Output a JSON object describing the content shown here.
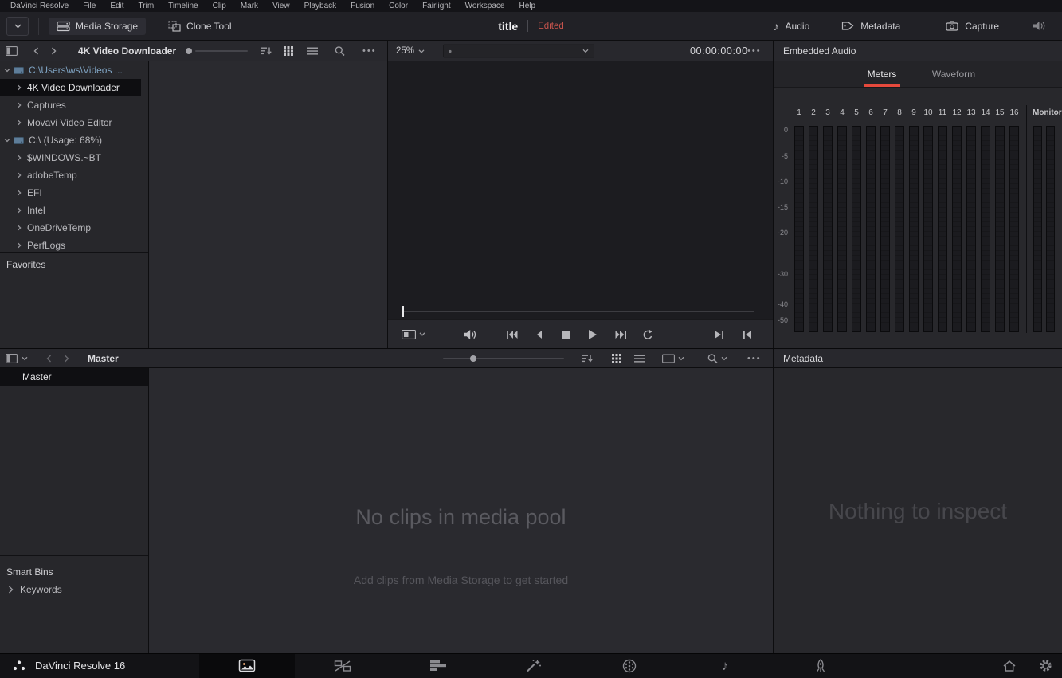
{
  "menubar": {
    "items": [
      "DaVinci Resolve",
      "File",
      "Edit",
      "Trim",
      "Timeline",
      "Clip",
      "Mark",
      "View",
      "Playback",
      "Fusion",
      "Color",
      "Fairlight",
      "Workspace",
      "Help"
    ]
  },
  "toolbar": {
    "media_storage_label": "Media Storage",
    "clone_tool_label": "Clone Tool",
    "project_title": "title",
    "project_status": "Edited",
    "audio_label": "Audio",
    "metadata_label": "Metadata",
    "capture_label": "Capture"
  },
  "storage_header": {
    "breadcrumb": "4K Video Downloader"
  },
  "viewer": {
    "zoom_value": "25%",
    "timecode": "00:00:00:00"
  },
  "storage_tree": {
    "items": [
      {
        "label": "C:\\Users\\ws\\Videos ...",
        "kind": "disk",
        "expanded": true,
        "accent": true
      },
      {
        "label": "4K Video Downloader",
        "kind": "folder",
        "selected": true
      },
      {
        "label": "Captures",
        "kind": "folder"
      },
      {
        "label": "Movavi Video Editor",
        "kind": "folder"
      },
      {
        "label": "C:\\ (Usage: 68%)",
        "kind": "disk",
        "expanded": true
      },
      {
        "label": "$WINDOWS.~BT",
        "kind": "folder"
      },
      {
        "label": "adobeTemp",
        "kind": "folder"
      },
      {
        "label": "EFI",
        "kind": "folder"
      },
      {
        "label": "Intel",
        "kind": "folder"
      },
      {
        "label": "OneDriveTemp",
        "kind": "folder"
      },
      {
        "label": "PerfLogs",
        "kind": "folder"
      }
    ],
    "favorites_label": "Favorites"
  },
  "audio_panel": {
    "title": "Embedded Audio",
    "tabs": [
      {
        "label": "Meters",
        "active": true
      },
      {
        "label": "Waveform",
        "active": false
      }
    ],
    "channels": [
      "1",
      "2",
      "3",
      "4",
      "5",
      "6",
      "7",
      "8",
      "9",
      "10",
      "11",
      "12",
      "13",
      "14",
      "15",
      "16"
    ],
    "monitor_label": "Monitor",
    "db_labels": [
      "0",
      "-5",
      "-10",
      "-15",
      "-20",
      "-30",
      "-40",
      "-50"
    ]
  },
  "media_pool": {
    "header_label": "Master",
    "bins": [
      {
        "label": "Master",
        "selected": true
      }
    ],
    "smart_bins_label": "Smart Bins",
    "keywords_label": "Keywords",
    "empty_title": "No clips in media pool",
    "empty_subtitle": "Add clips from Media Storage to get started"
  },
  "metadata_panel": {
    "title": "Metadata",
    "empty_text": "Nothing to inspect"
  },
  "statusbar": {
    "app_label": "DaVinci Resolve 16",
    "pages": [
      {
        "name": "media",
        "active": true
      },
      {
        "name": "cut",
        "active": false
      },
      {
        "name": "edit",
        "active": false
      },
      {
        "name": "fusion",
        "active": false
      },
      {
        "name": "color",
        "active": false
      },
      {
        "name": "fairlight",
        "active": false
      },
      {
        "name": "deliver",
        "active": false
      }
    ]
  },
  "colors": {
    "accent_red": "#e5493c",
    "status_red": "#c4534c",
    "tree_accent_blue": "#7fa3c2"
  }
}
